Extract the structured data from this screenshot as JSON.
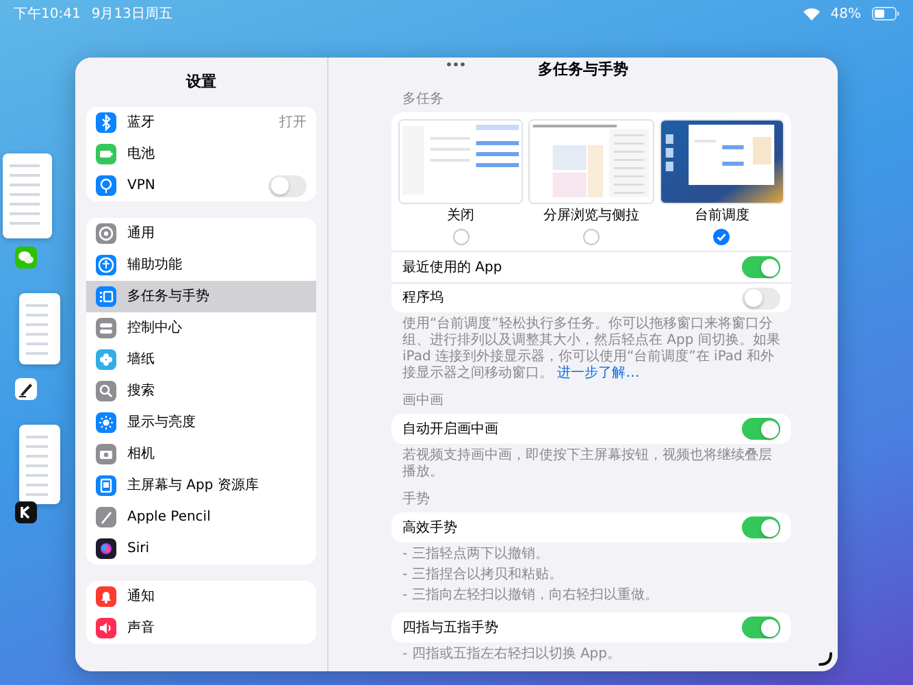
{
  "status_bar": {
    "time": "下午10:41",
    "date": "9月13日周五",
    "battery": "48%"
  },
  "sidebar": {
    "title": "设置",
    "groups": [
      {
        "items": [
          {
            "label": "蓝牙",
            "kind": "value",
            "value": "打开",
            "selected": false
          },
          {
            "label": "电池",
            "kind": "link",
            "selected": false
          },
          {
            "label": "VPN",
            "kind": "toggle",
            "on": false,
            "selected": false
          }
        ]
      },
      {
        "items": [
          {
            "label": "通用",
            "kind": "link",
            "selected": false
          },
          {
            "label": "辅助功能",
            "kind": "link",
            "selected": false
          },
          {
            "label": "多任务与手势",
            "kind": "link",
            "selected": true
          },
          {
            "label": "控制中心",
            "kind": "link",
            "selected": false
          },
          {
            "label": "墙纸",
            "kind": "link",
            "selected": false
          },
          {
            "label": "搜索",
            "kind": "link",
            "selected": false
          },
          {
            "label": "显示与亮度",
            "kind": "link",
            "selected": false
          },
          {
            "label": "相机",
            "kind": "link",
            "selected": false
          },
          {
            "label": "主屏幕与 App 资源库",
            "kind": "link",
            "selected": false
          },
          {
            "label": "Apple Pencil",
            "kind": "link",
            "selected": false
          },
          {
            "label": "Siri",
            "kind": "link",
            "selected": false
          }
        ]
      },
      {
        "items": [
          {
            "label": "通知",
            "kind": "link",
            "selected": false
          },
          {
            "label": "声音",
            "kind": "link",
            "selected": false
          }
        ]
      }
    ]
  },
  "detail": {
    "title": "多任务与手势",
    "sections": [
      {
        "header": "多任务",
        "options": [
          {
            "label": "关闭",
            "selected": false
          },
          {
            "label": "分屏浏览与侧拉",
            "selected": false
          },
          {
            "label": "台前调度",
            "selected": true
          }
        ],
        "rows": [
          {
            "label": "最近使用的 App",
            "on": true
          },
          {
            "label": "程序坞",
            "on": false
          }
        ],
        "footer": [
          "使用“台前调度”轻松执行多任务。你可以拖移窗口来将窗口分组、进行排列以及调整其大小，然后轻点在 App 间切换。如果 iPad 连接到外接显示器，你可以使用“台前调度”在 iPad 和外接显示器之间移动窗口。"
        ],
        "link": "进一步了解…"
      },
      {
        "header": "画中画",
        "rows": [
          {
            "label": "自动开启画中画",
            "on": true
          }
        ],
        "footer": [
          "若视频支持画中画，即使按下主屏幕按钮，视频也将继续叠层播放。"
        ]
      },
      {
        "header": "手势",
        "rows": [
          {
            "label": "高效手势",
            "on": true
          }
        ],
        "footer": [
          "- 三指轻点两下以撤销。",
          "- 三指捏合以拷贝和粘贴。",
          "- 三指向左轻扫以撤销，向右轻扫以重做。"
        ]
      },
      {
        "rows": [
          {
            "label": "四指与五指手势",
            "on": true
          }
        ],
        "footer": [
          "- 四指或五指左右轻扫以切换 App。"
        ]
      }
    ]
  }
}
